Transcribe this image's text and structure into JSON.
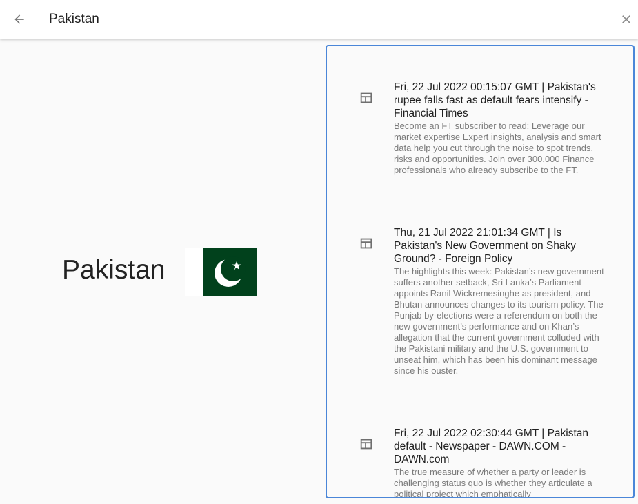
{
  "search": {
    "value": "Pakistan"
  },
  "country": {
    "name": "Pakistan",
    "flag_colors": {
      "green": "#01411c",
      "white": "#ffffff"
    }
  },
  "colors": {
    "accent_border": "#4a86d8"
  },
  "results": [
    {
      "title": "Fri, 22 Jul 2022 00:15:07 GMT | Pakistan's rupee falls fast as default fears intensify - Financial Times",
      "snippet": "Become an FT subscriber to read:  Leverage our market expertise  Expert insights, analysis and smart data help you cut through the noise to spot trends, risks and opportunities.   Join over 300,000 Finance professionals who already subscribe to the FT."
    },
    {
      "title": "Thu, 21 Jul 2022 21:01:34 GMT | Is Pakistan's New Government on Shaky Ground? - Foreign Policy",
      "snippet": "  The highlights this week: Pakistan’s new government suffers another setback, Sri Lanka’s Parliament appoints Ranil Wickremesinghe as president, and Bhutan announces changes to its tourism policy.   The Punjab by-elections were a referendum on both the new government’s performance and on Khan’s allegation that the current government colluded with the Pakistani military and the U.S. government to unseat him, which has been his dominant message since his ouster."
    },
    {
      "title": "Fri, 22 Jul 2022 02:30:44 GMT | Pakistan default - Newspaper - DAWN.COM - DAWN.com",
      "snippet": "The true measure of whether a party or leader is challenging status quo is whether they articulate a political project which emphatically"
    }
  ]
}
